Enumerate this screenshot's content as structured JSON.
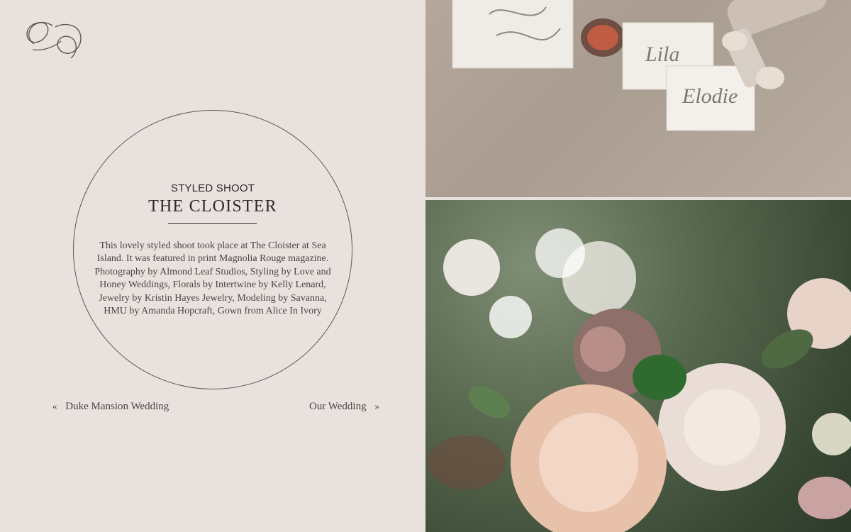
{
  "brand": {
    "logo_icon": "monogram-logo-icon"
  },
  "post": {
    "category": "STYLED SHOOT",
    "title": "THE CLOISTER",
    "description": "This lovely styled shoot took place at The Cloister at Sea Island. It was featured in print Magnolia Rouge magazine. Photography by Almond Leaf Studios, Styling by Love and Honey Weddings, Florals by Intertwine by Kelly Lenard, Jewelry by Kristin Hayes Jewelry, Modeling by Savanna, HMU by Amanda Hopcraft, Gown from Alice In Ivory"
  },
  "pagination": {
    "prev_arrow": "«",
    "prev_label": "Duke Mansion Wedding",
    "next_label": "Our Wedding",
    "next_arrow": "»"
  },
  "header": {
    "menu_icon": "hamburger-menu-icon"
  },
  "photos": {
    "top_card_1": "Lila",
    "top_card_2": "Elodie"
  },
  "colors": {
    "background": "#e9e1dd",
    "text": "#4a4442",
    "accent": "#2f2a29"
  }
}
